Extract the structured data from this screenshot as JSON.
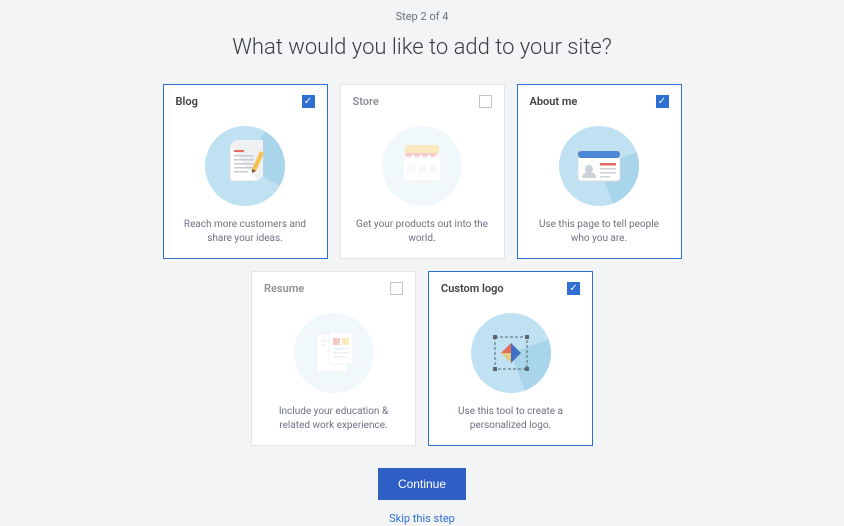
{
  "step": "Step 2 of 4",
  "heading": "What would you like to add to your site?",
  "cards": [
    {
      "title": "Blog",
      "desc": "Reach more customers and share your ideas.",
      "selected": true
    },
    {
      "title": "Store",
      "desc": "Get your products out into the world.",
      "selected": false
    },
    {
      "title": "About me",
      "desc": "Use this page to tell people who you are.",
      "selected": true
    },
    {
      "title": "Resume",
      "desc": "Include your education & related work experience.",
      "selected": false
    },
    {
      "title": "Custom logo",
      "desc": "Use this tool to create a personalized logo.",
      "selected": true
    }
  ],
  "buttons": {
    "continue": "Continue",
    "skip": "Skip this step"
  }
}
